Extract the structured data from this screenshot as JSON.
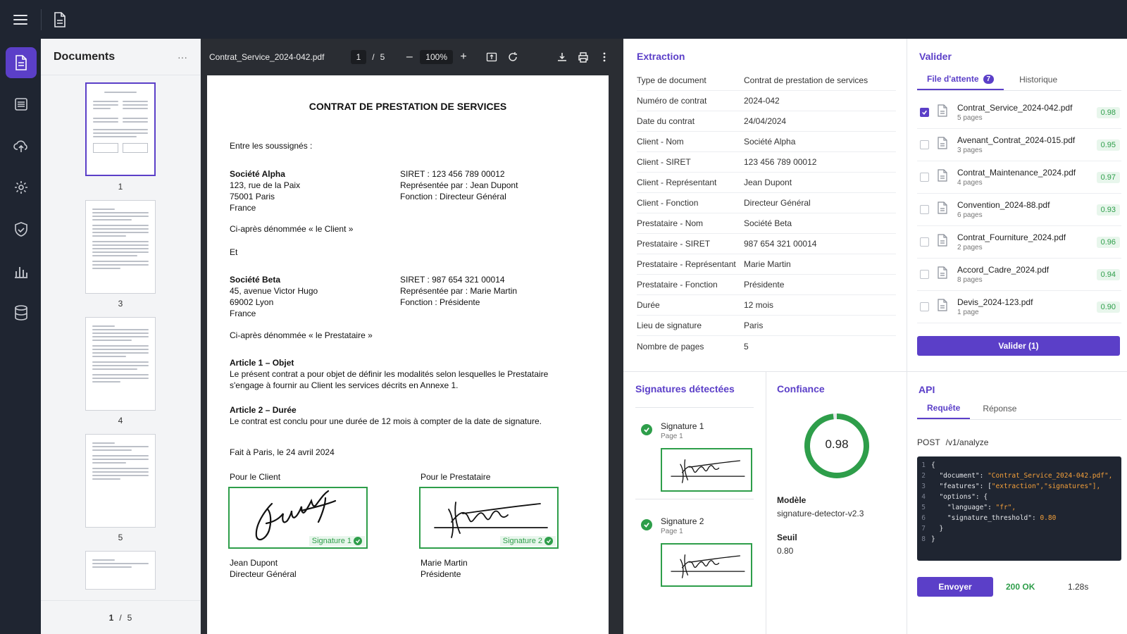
{
  "sidebar_header": {
    "title": "Documents",
    "more": "···"
  },
  "thumbs": [
    {
      "label": "1"
    },
    {
      "label": "3"
    },
    {
      "label": "4"
    },
    {
      "label": "5"
    }
  ],
  "thumb_pager": {
    "current": "1",
    "sep": "/",
    "total": "5"
  },
  "viewer": {
    "filename": "Contrat_Service_2024-042.pdf",
    "page_current": "1",
    "page_sep": "/",
    "page_total": "5",
    "zoom_minus": "–",
    "zoom": "100%",
    "zoom_plus": "+"
  },
  "doc": {
    "title": "CONTRAT DE PRESTATION DE SERVICES",
    "intro": "Entre les soussignés :",
    "party1_name": "Société Alpha",
    "party1_addr1": "123, rue de la Paix",
    "party1_addr2": "75001 Paris",
    "party1_addr3": "France",
    "party1_siret": "SIRET : 123 456 789 00012",
    "party1_rep": "Représentée par : Jean Dupont",
    "party1_fn": "Fonction : Directeur Général",
    "party1_alias": "Ci-après dénommée « le Client »",
    "et": "Et",
    "party2_name": "Société Beta",
    "party2_addr1": "45, avenue Victor Hugo",
    "party2_addr2": "69002 Lyon",
    "party2_addr3": "France",
    "party2_siret": "SIRET : 987 654 321 00014",
    "party2_rep": "Représentée par : Marie Martin",
    "party2_fn": "Fonction : Présidente",
    "party2_alias": "Ci-après dénommée « le Prestataire »",
    "art1_title": "Article 1 – Objet",
    "art1_l1": "Le présent contrat a pour objet de définir les modalités selon lesquelles le Prestataire",
    "art1_l2": "s'engage à fournir au Client les services décrits en Annexe 1.",
    "art2_title": "Article 2 – Durée",
    "art2_l1": "Le contrat est conclu pour une durée de 12 mois à compter de la date de signature.",
    "done": "Fait à Paris, le 24 avril 2024",
    "for_client": "Pour le Client",
    "for_prest": "Pour le Prestataire",
    "sig1_tag": "Signature 1",
    "sig2_tag": "Signature 2",
    "sign1_name": "Jean Dupont",
    "sign1_role": "Directeur Général",
    "sign2_name": "Marie Martin",
    "sign2_role": "Présidente"
  },
  "extraction": {
    "title": "Extraction",
    "rows": [
      {
        "k": "Type de document",
        "v": "Contrat de prestation de services"
      },
      {
        "k": "Numéro de contrat",
        "v": "2024-042"
      },
      {
        "k": "Date du contrat",
        "v": "24/04/2024"
      },
      {
        "k": "Client - Nom",
        "v": "Société Alpha"
      },
      {
        "k": "Client - SIRET",
        "v": "123 456 789 00012"
      },
      {
        "k": "Client - Représentant",
        "v": "Jean Dupont"
      },
      {
        "k": "Client - Fonction",
        "v": "Directeur Général"
      },
      {
        "k": "Prestataire - Nom",
        "v": "Société Beta"
      },
      {
        "k": "Prestataire - SIRET",
        "v": "987 654 321 00014"
      },
      {
        "k": "Prestataire - Représentant",
        "v": "Marie Martin"
      },
      {
        "k": "Prestataire - Fonction",
        "v": "Présidente"
      },
      {
        "k": "Durée",
        "v": "12 mois"
      },
      {
        "k": "Lieu de signature",
        "v": "Paris"
      },
      {
        "k": "Nombre de pages",
        "v": "5"
      }
    ]
  },
  "signatures": {
    "title": "Signatures détectées",
    "items": [
      {
        "name": "Signature 1",
        "page": "Page 1"
      },
      {
        "name": "Signature 2",
        "page": "Page 1"
      }
    ]
  },
  "confidence": {
    "title": "Confiance",
    "value": "0.98",
    "fraction": 0.98,
    "model_label": "Modèle",
    "model": "signature-detector-v2.3",
    "threshold_label": "Seuil",
    "threshold": "0.80"
  },
  "valider": {
    "title": "Valider",
    "tab_queue": "File d'attente",
    "queue_count": "7",
    "tab_history": "Historique",
    "queue": [
      {
        "name": "Contrat_Service_2024-042.pdf",
        "pages": "5 pages",
        "score": "0.98",
        "checked": true
      },
      {
        "name": "Avenant_Contrat_2024-015.pdf",
        "pages": "3 pages",
        "score": "0.95",
        "checked": false
      },
      {
        "name": "Contrat_Maintenance_2024.pdf",
        "pages": "4 pages",
        "score": "0.97",
        "checked": false
      },
      {
        "name": "Convention_2024-88.pdf",
        "pages": "6 pages",
        "score": "0.93",
        "checked": false
      },
      {
        "name": "Contrat_Fourniture_2024.pdf",
        "pages": "2 pages",
        "score": "0.96",
        "checked": false
      },
      {
        "name": "Accord_Cadre_2024.pdf",
        "pages": "8 pages",
        "score": "0.94",
        "checked": false
      },
      {
        "name": "Devis_2024-123.pdf",
        "pages": "1 page",
        "score": "0.90",
        "checked": false
      }
    ],
    "button": "Valider (1)"
  },
  "api": {
    "title": "API",
    "tab_request": "Requête",
    "tab_response": "Réponse",
    "method": "POST",
    "path": "/v1/analyze",
    "code": [
      {
        "n": "1",
        "t": "{",
        "s": ""
      },
      {
        "n": "2",
        "t": "  \"document\": ",
        "s": "\"Contrat_Service_2024-042.pdf\","
      },
      {
        "n": "3",
        "t": "  \"features\": [",
        "s": "\"extraction\",\"signatures\"],"
      },
      {
        "n": "4",
        "t": "  \"options\": {",
        "s": ""
      },
      {
        "n": "5",
        "t": "    \"language\": ",
        "s": "\"fr\","
      },
      {
        "n": "6",
        "t": "    \"signature_threshold\": ",
        "s": "0.80"
      },
      {
        "n": "7",
        "t": "  }",
        "s": ""
      },
      {
        "n": "8",
        "t": "}",
        "s": ""
      }
    ],
    "send": "Envoyer",
    "status": "200 OK",
    "time": "1.28s"
  },
  "colors": {
    "accent": "#5b3fc8",
    "success": "#2e9e4a",
    "dark": "#1f2531"
  },
  "icons": [
    "menu-icon",
    "file-icon",
    "document-icon",
    "list-icon",
    "cloud-upload-icon",
    "gear-icon",
    "shield-icon",
    "bar-chart-icon",
    "database-icon"
  ]
}
